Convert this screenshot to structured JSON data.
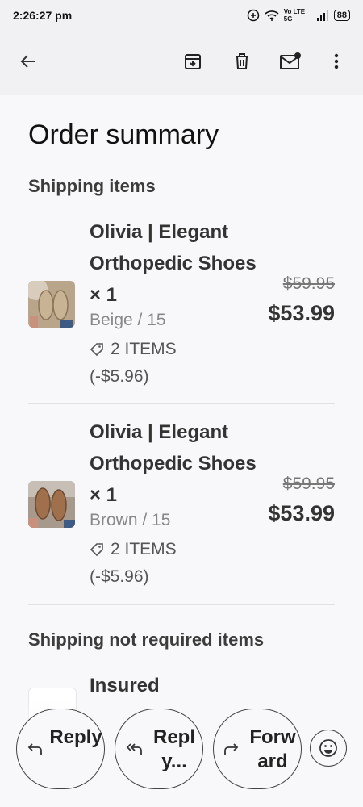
{
  "status_bar": {
    "time": "2:26:27 pm",
    "network_label": "Vo LTE 5G",
    "battery": "88"
  },
  "toolbar": {
    "back_icon": "arrow-left-icon",
    "archive_icon": "archive-icon",
    "delete_icon": "trash-icon",
    "mark_unread_icon": "mail-unread-icon",
    "more_icon": "more-vert-icon"
  },
  "content": {
    "title": "Order summary",
    "shipping_section_title": "Shipping items",
    "items": [
      {
        "name": "Olivia | Elegant Orthopedic Shoes × 1",
        "variant": "Beige / 15",
        "discount": "2 ITEMS (-$5.96)",
        "original_price": "$59.95",
        "price": "$53.99"
      },
      {
        "name": "Olivia | Elegant Orthopedic Shoes × 1",
        "variant": "Brown / 15",
        "discount": "2 ITEMS (-$5.96)",
        "original_price": "$59.95",
        "price": "$53.99"
      }
    ],
    "no_shipping_section_title": "Shipping not required items",
    "no_shipping_items": [
      {
        "name": "Insured"
      }
    ]
  },
  "reply_bar": {
    "reply_label": "Reply",
    "reply_all_label": "Reply...",
    "forward_label": "Forward",
    "emoji_icon": "emoji-smile-icon"
  }
}
